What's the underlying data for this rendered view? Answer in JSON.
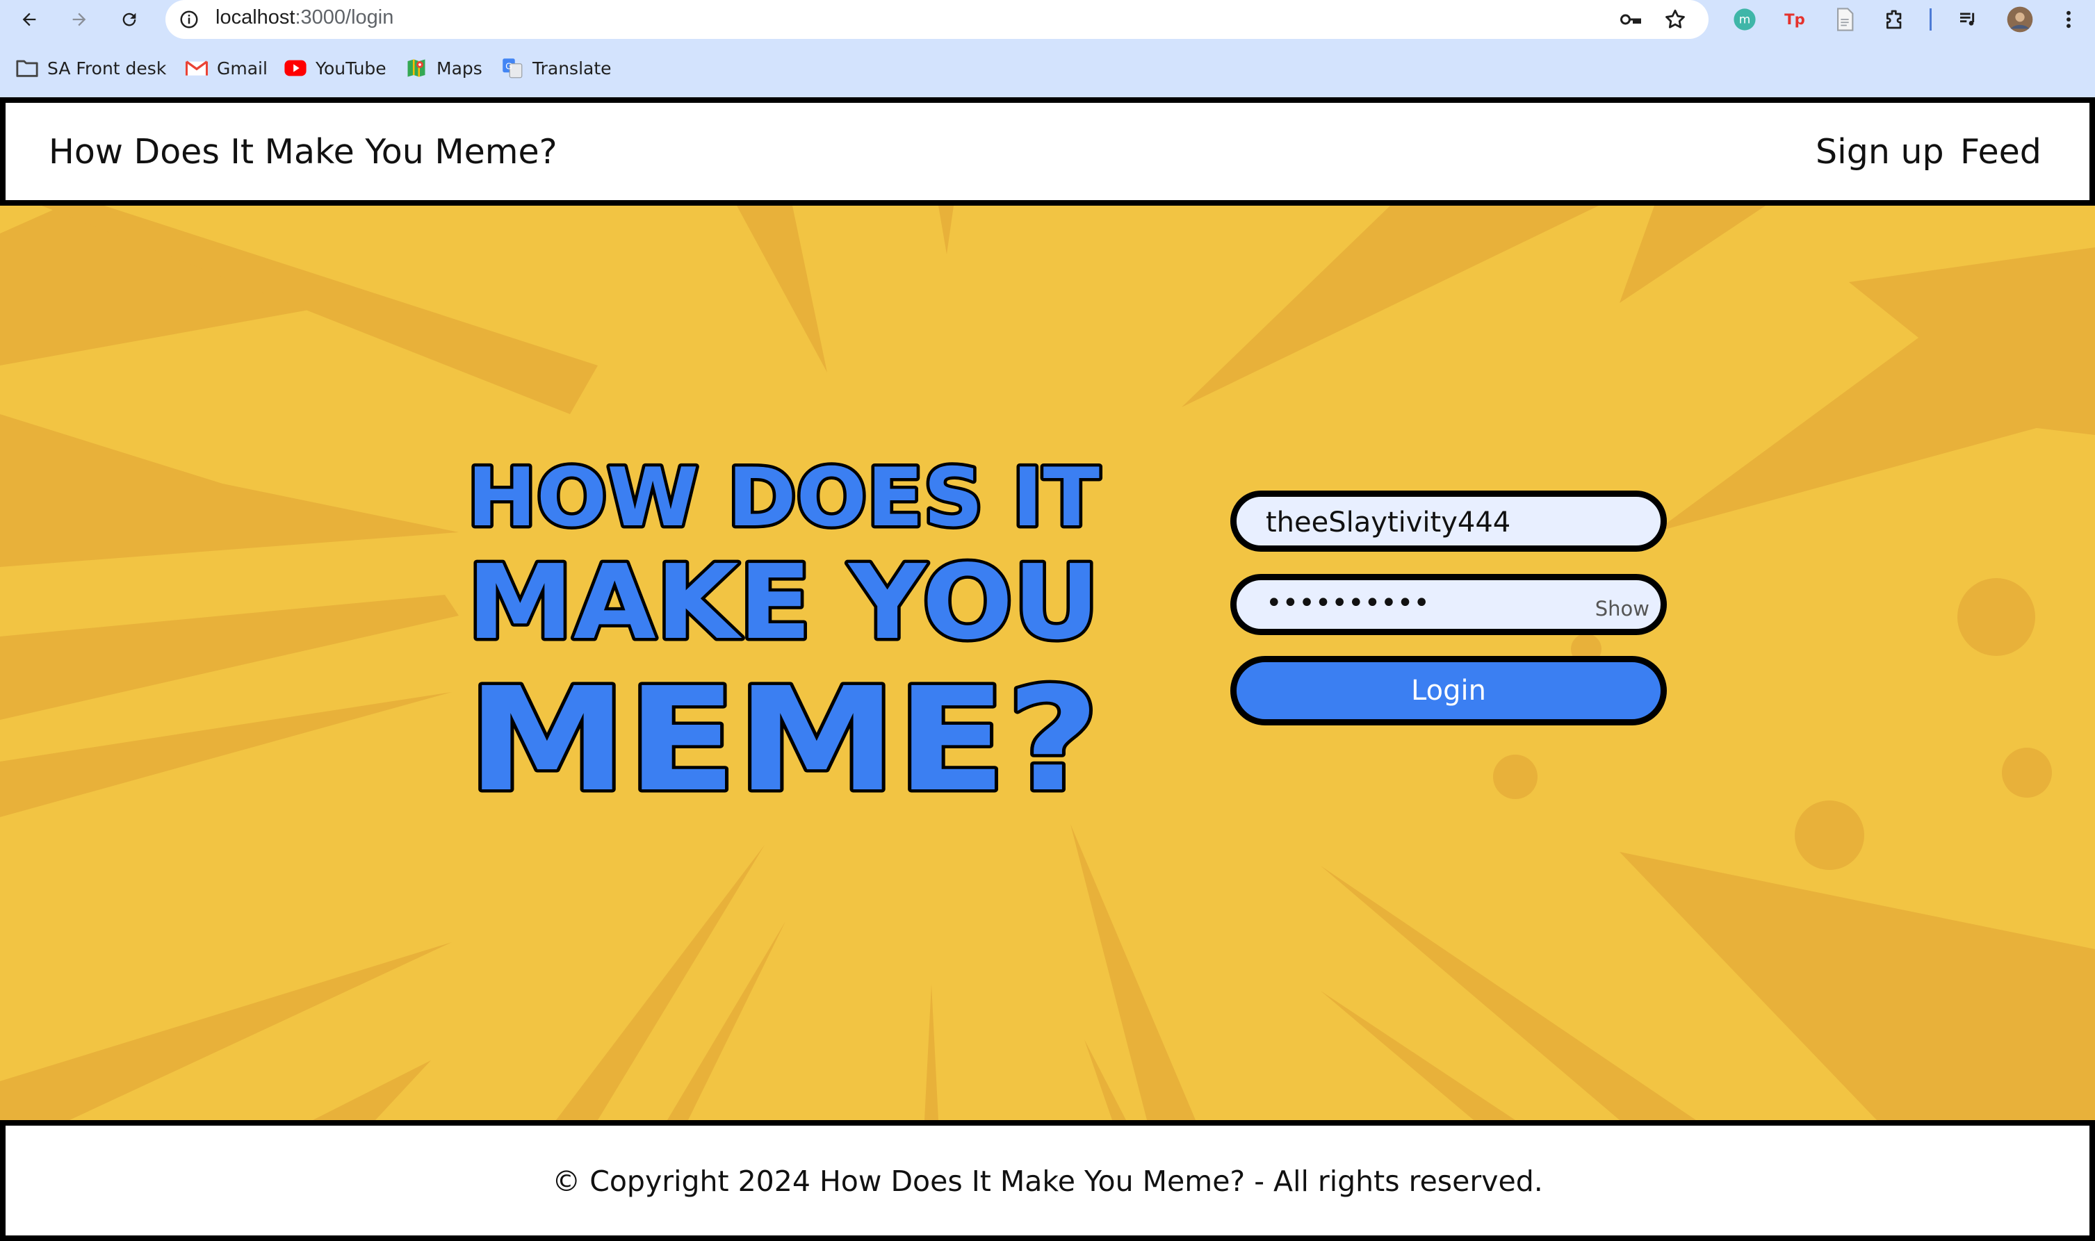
{
  "browser": {
    "url_host": "localhost",
    "url_path": ":3000/login",
    "bookmarks": [
      {
        "label": "SA Front desk",
        "icon": "folder-icon"
      },
      {
        "label": "Gmail",
        "icon": "gmail-icon"
      },
      {
        "label": "YouTube",
        "icon": "youtube-icon"
      },
      {
        "label": "Maps",
        "icon": "maps-icon"
      },
      {
        "label": "Translate",
        "icon": "translate-icon"
      }
    ]
  },
  "navbar": {
    "brand": "How Does It Make You Meme?",
    "links": [
      "Sign up",
      "Feed"
    ]
  },
  "logo": {
    "line1": "HOW DOES IT",
    "line2": "MAKE YOU",
    "line3": "MEME?"
  },
  "login_form": {
    "username_value": "theeSlaytivity444",
    "password_value": "••••••••••",
    "show_label": "Show",
    "login_label": "Login"
  },
  "footer": {
    "copyright": "© Copyright 2024 How Does It Make You Meme? - All rights reserved."
  },
  "colors": {
    "background_yellow": "#f2c443",
    "ray_yellow": "#e8b13a",
    "accent_blue": "#3b7ff2",
    "input_bg": "#e8efff"
  }
}
